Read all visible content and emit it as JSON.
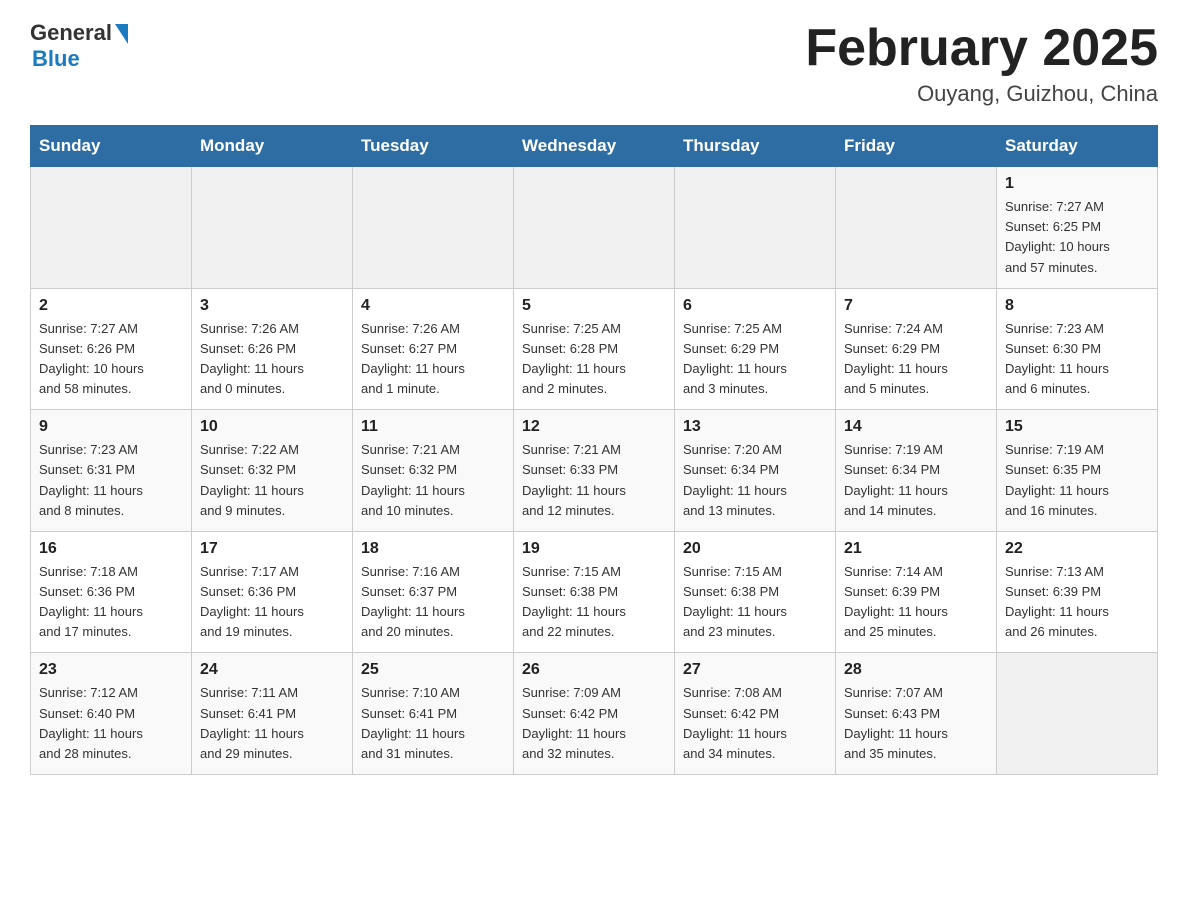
{
  "header": {
    "logo_general": "General",
    "logo_blue": "Blue",
    "title": "February 2025",
    "subtitle": "Ouyang, Guizhou, China"
  },
  "weekdays": [
    "Sunday",
    "Monday",
    "Tuesday",
    "Wednesday",
    "Thursday",
    "Friday",
    "Saturday"
  ],
  "weeks": [
    [
      {
        "day": "",
        "info": ""
      },
      {
        "day": "",
        "info": ""
      },
      {
        "day": "",
        "info": ""
      },
      {
        "day": "",
        "info": ""
      },
      {
        "day": "",
        "info": ""
      },
      {
        "day": "",
        "info": ""
      },
      {
        "day": "1",
        "info": "Sunrise: 7:27 AM\nSunset: 6:25 PM\nDaylight: 10 hours\nand 57 minutes."
      }
    ],
    [
      {
        "day": "2",
        "info": "Sunrise: 7:27 AM\nSunset: 6:26 PM\nDaylight: 10 hours\nand 58 minutes."
      },
      {
        "day": "3",
        "info": "Sunrise: 7:26 AM\nSunset: 6:26 PM\nDaylight: 11 hours\nand 0 minutes."
      },
      {
        "day": "4",
        "info": "Sunrise: 7:26 AM\nSunset: 6:27 PM\nDaylight: 11 hours\nand 1 minute."
      },
      {
        "day": "5",
        "info": "Sunrise: 7:25 AM\nSunset: 6:28 PM\nDaylight: 11 hours\nand 2 minutes."
      },
      {
        "day": "6",
        "info": "Sunrise: 7:25 AM\nSunset: 6:29 PM\nDaylight: 11 hours\nand 3 minutes."
      },
      {
        "day": "7",
        "info": "Sunrise: 7:24 AM\nSunset: 6:29 PM\nDaylight: 11 hours\nand 5 minutes."
      },
      {
        "day": "8",
        "info": "Sunrise: 7:23 AM\nSunset: 6:30 PM\nDaylight: 11 hours\nand 6 minutes."
      }
    ],
    [
      {
        "day": "9",
        "info": "Sunrise: 7:23 AM\nSunset: 6:31 PM\nDaylight: 11 hours\nand 8 minutes."
      },
      {
        "day": "10",
        "info": "Sunrise: 7:22 AM\nSunset: 6:32 PM\nDaylight: 11 hours\nand 9 minutes."
      },
      {
        "day": "11",
        "info": "Sunrise: 7:21 AM\nSunset: 6:32 PM\nDaylight: 11 hours\nand 10 minutes."
      },
      {
        "day": "12",
        "info": "Sunrise: 7:21 AM\nSunset: 6:33 PM\nDaylight: 11 hours\nand 12 minutes."
      },
      {
        "day": "13",
        "info": "Sunrise: 7:20 AM\nSunset: 6:34 PM\nDaylight: 11 hours\nand 13 minutes."
      },
      {
        "day": "14",
        "info": "Sunrise: 7:19 AM\nSunset: 6:34 PM\nDaylight: 11 hours\nand 14 minutes."
      },
      {
        "day": "15",
        "info": "Sunrise: 7:19 AM\nSunset: 6:35 PM\nDaylight: 11 hours\nand 16 minutes."
      }
    ],
    [
      {
        "day": "16",
        "info": "Sunrise: 7:18 AM\nSunset: 6:36 PM\nDaylight: 11 hours\nand 17 minutes."
      },
      {
        "day": "17",
        "info": "Sunrise: 7:17 AM\nSunset: 6:36 PM\nDaylight: 11 hours\nand 19 minutes."
      },
      {
        "day": "18",
        "info": "Sunrise: 7:16 AM\nSunset: 6:37 PM\nDaylight: 11 hours\nand 20 minutes."
      },
      {
        "day": "19",
        "info": "Sunrise: 7:15 AM\nSunset: 6:38 PM\nDaylight: 11 hours\nand 22 minutes."
      },
      {
        "day": "20",
        "info": "Sunrise: 7:15 AM\nSunset: 6:38 PM\nDaylight: 11 hours\nand 23 minutes."
      },
      {
        "day": "21",
        "info": "Sunrise: 7:14 AM\nSunset: 6:39 PM\nDaylight: 11 hours\nand 25 minutes."
      },
      {
        "day": "22",
        "info": "Sunrise: 7:13 AM\nSunset: 6:39 PM\nDaylight: 11 hours\nand 26 minutes."
      }
    ],
    [
      {
        "day": "23",
        "info": "Sunrise: 7:12 AM\nSunset: 6:40 PM\nDaylight: 11 hours\nand 28 minutes."
      },
      {
        "day": "24",
        "info": "Sunrise: 7:11 AM\nSunset: 6:41 PM\nDaylight: 11 hours\nand 29 minutes."
      },
      {
        "day": "25",
        "info": "Sunrise: 7:10 AM\nSunset: 6:41 PM\nDaylight: 11 hours\nand 31 minutes."
      },
      {
        "day": "26",
        "info": "Sunrise: 7:09 AM\nSunset: 6:42 PM\nDaylight: 11 hours\nand 32 minutes."
      },
      {
        "day": "27",
        "info": "Sunrise: 7:08 AM\nSunset: 6:42 PM\nDaylight: 11 hours\nand 34 minutes."
      },
      {
        "day": "28",
        "info": "Sunrise: 7:07 AM\nSunset: 6:43 PM\nDaylight: 11 hours\nand 35 minutes."
      },
      {
        "day": "",
        "info": ""
      }
    ]
  ]
}
